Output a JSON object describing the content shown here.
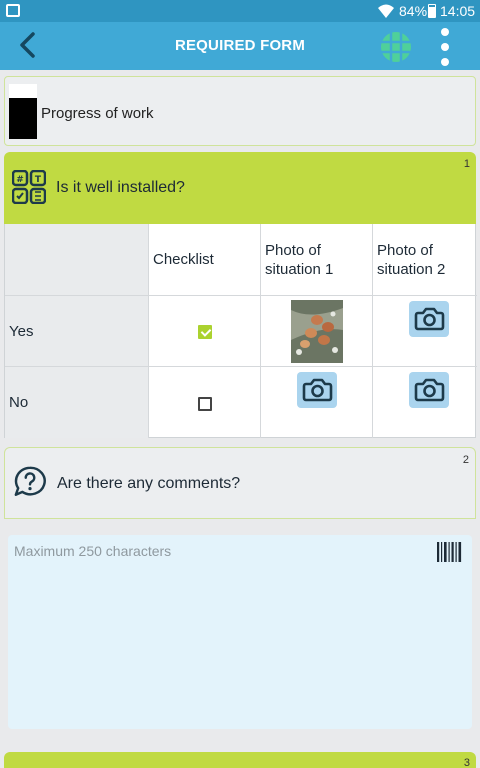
{
  "status_bar": {
    "battery": "84%",
    "time": "14:05"
  },
  "app_bar": {
    "title": "REQUIRED FORM"
  },
  "section": {
    "label": "Progress of work"
  },
  "question1": {
    "number": "1",
    "text": "Is it well installed?",
    "columns": [
      "",
      "Checklist",
      "Photo of situation 1",
      "Photo of situation 2"
    ],
    "rows": [
      {
        "label": "Yes",
        "checked": true,
        "photo1": "photo",
        "photo2": "camera"
      },
      {
        "label": "No",
        "checked": false,
        "photo1": "camera",
        "photo2": "camera"
      }
    ]
  },
  "question2": {
    "number": "2",
    "text": "Are there any comments?",
    "placeholder": "Maximum 250 characters"
  },
  "question3": {
    "number": "3"
  },
  "colors": {
    "status_bar": "#2f95c1",
    "app_bar": "#40a9d6",
    "accent_green": "#c0da42",
    "camera_bg": "#aad4ee",
    "input_bg": "#e3f3fb"
  }
}
